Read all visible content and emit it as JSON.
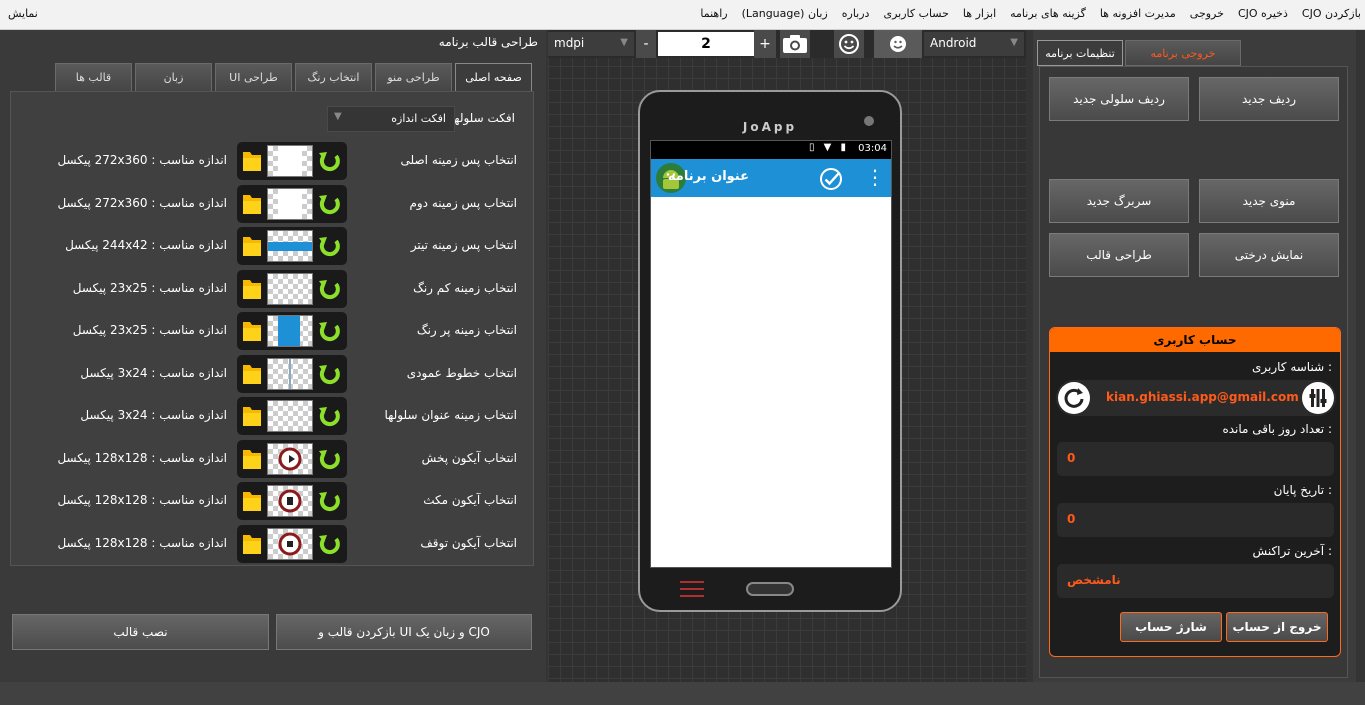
{
  "menubar": {
    "items": [
      "بازکردن CJO",
      "ذخیره CJO",
      "خروجی",
      "مدیرت افزونه ها",
      "گزینه های برنامه",
      "ابزار ها",
      "حساب کاربری",
      "درباره",
      "زبان (Language)",
      "راهنما"
    ],
    "right_item": "نمایش"
  },
  "left_panel": {
    "title": "طراحی قالب برنامه",
    "tabs": [
      "صفحه اصلی",
      "طراحی منو",
      "انتخاب رنگ",
      "طراحی UI",
      "زبان",
      "قالب ها"
    ],
    "size_effect": {
      "label": "افکت سلولها",
      "value": "افکت اندازه"
    },
    "rows": [
      {
        "label": "انتخاب پس زمینه اصلی",
        "size": "اندازه مناسب : 272x360 پیکسل"
      },
      {
        "label": "انتخاب پس زمینه دوم",
        "size": "اندازه مناسب : 272x360 پیکسل"
      },
      {
        "label": "انتخاب پس زمینه تیتر",
        "size": "اندازه مناسب : 244x42 پیکسل"
      },
      {
        "label": "انتخاب زمینه کم رنگ",
        "size": "اندازه مناسب : 23x25 پیکسل"
      },
      {
        "label": "انتخاب زمینه پر رنگ",
        "size": "اندازه مناسب : 23x25 پیکسل"
      },
      {
        "label": "انتخاب خطوط عمودی",
        "size": "اندازه مناسب : 3x24 پیکسل"
      },
      {
        "label": "انتخاب زمینه عنوان سلولها",
        "size": "اندازه مناسب : 3x24 پیکسل"
      },
      {
        "label": "انتخاب آیکون پخش",
        "size": "اندازه مناسب : 128x128 پیکسل"
      },
      {
        "label": "انتخاب آیکون مکث",
        "size": "اندازه مناسب : 128x128 پیکسل"
      },
      {
        "label": "انتخاب آیکون توقف",
        "size": "اندازه مناسب : 128x128 پیکسل"
      }
    ],
    "reset_button": "بازکردن قالب و UI و زبان یک CJO",
    "install_button": "نصب قالب"
  },
  "toolbar": {
    "density": "mdpi",
    "minus": "-",
    "zoom": "2",
    "plus": "+",
    "platform": "Android"
  },
  "phone": {
    "brand": "JoApp",
    "time": "03:04",
    "app_title": "عنوان برنامه"
  },
  "right_panel": {
    "tabs": [
      "تنظیمات برنامه",
      "خروجی برنامه"
    ],
    "buttons": {
      "new_row": "ردیف جدید",
      "new_cell_row": "ردیف سلولی جدید",
      "new_menu": "منوی جدید",
      "new_header": "سربرگ جدید",
      "tree_view": "نمایش درختی",
      "template_design": "طراحی قالب"
    },
    "account": {
      "title": "حساب کاربری",
      "user_id_label": "شناسه کاربری :",
      "email": "kian.ghiassi.app@gmail.com",
      "days_label": "تعداد روز باقی مانده :",
      "days_value": "0",
      "end_date_label": "تاریخ پایان :",
      "end_date_value": "0",
      "last_tx_label": "آخرین تراکنش :",
      "last_tx_value": "نامشخص",
      "logout_button": "خروج از حساب",
      "charge_button": "شارژ حساب"
    }
  },
  "colors": {
    "accent": "#ff6a00",
    "app_header": "#1e90d6"
  }
}
